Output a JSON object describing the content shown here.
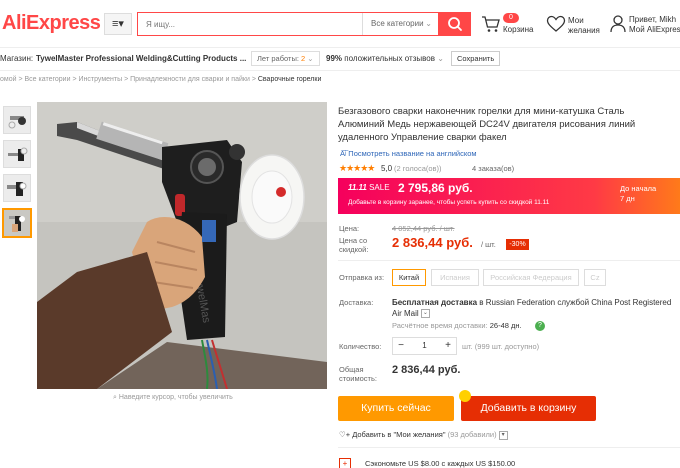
{
  "header": {
    "logo": "AliExpress",
    "menu_icon": "≡▾",
    "search_placeholder": "Я ищу...",
    "search_category": "Все категории",
    "cart_count": "0",
    "cart_label": "Корзина",
    "wishlist_label_1": "Мои",
    "wishlist_label_2": "желания",
    "greeting": "Привет, Mikh",
    "account_label": "Мой AliExpress"
  },
  "store": {
    "prefix": "Магазин:",
    "name": "TywelMaster Professional Welding&Cutting Products ...",
    "years_label": "Лет работы:",
    "years": "2",
    "rating_value": "99%",
    "rating_label": "положительных отзывов",
    "save_label": "Сохранить"
  },
  "breadcrumb": [
    "омой",
    "Все категории",
    "Инструменты",
    "Принадлежности для сварки и пайки",
    "Сварочные горелки"
  ],
  "gallery": {
    "zoom_hint": "Наведите курсор, чтобы увеличить",
    "watermark": "TywelMas"
  },
  "product": {
    "title": "Безгазового сварки наконечник горелки для мини-катушка Сталь Алюминий Медь нержавеющей DC24V двигателя рисования линий удаленного Управление сварки факел",
    "translate_link": "Посмотреть название на английском",
    "stars": "★★★★★",
    "rating": "5,0",
    "votes": "(2 голоса(ов))",
    "orders": "4 заказа(ов)"
  },
  "promo": {
    "tag": "11.11",
    "sale_label": "SALE",
    "price": "2 795,86 руб.",
    "description": "Добавьте в корзину заранее, чтобы успеть купить со скидкой 11.11",
    "until_label": "До начала",
    "until_value": "7 дн"
  },
  "pricing": {
    "price_label": "Цена:",
    "old_price": "4 052,44 руб. / шт.",
    "discount_price_label_1": "Цена со",
    "discount_price_label_2": "скидкой:",
    "price": "2 836,44 руб.",
    "per_unit": "/ шт.",
    "discount": "-30%"
  },
  "shipping": {
    "from_label": "Отправка из:",
    "options": [
      "Китай",
      "Испания",
      "Российская Федерация",
      "Cz"
    ],
    "selected_index": 0,
    "delivery_label": "Доставка:",
    "delivery_bold": "Бесплатная доставка",
    "delivery_text": " в Russian Federation службой China Post Registered Air Mail",
    "estimate_label": "Расчётное время доставки:",
    "estimate_value": "26-48 дн.",
    "help_icon": "?"
  },
  "quantity": {
    "label": "Количество:",
    "minus": "−",
    "value": "1",
    "plus": "+",
    "note": "шт. (999 шт. доступно)"
  },
  "total": {
    "label_1": "Общая",
    "label_2": "стоимость:",
    "value": "2 836,44 руб."
  },
  "actions": {
    "buy_now": "Купить сейчас",
    "add_to_cart": "Добавить в корзину",
    "wishlist_heart": "♡+",
    "wishlist": "Добавить в \"Мои желания\"",
    "wishlist_count": "(93 добавили)",
    "wishlist_dropdown": "▾"
  },
  "savings": {
    "icon": "+",
    "text": "Сэкономьте US $8.00 с каждых US $150.00"
  },
  "colors": {
    "brand": "#ff4747",
    "orange": "#ff9900",
    "red": "#e62e04",
    "link": "#2e66b8"
  }
}
